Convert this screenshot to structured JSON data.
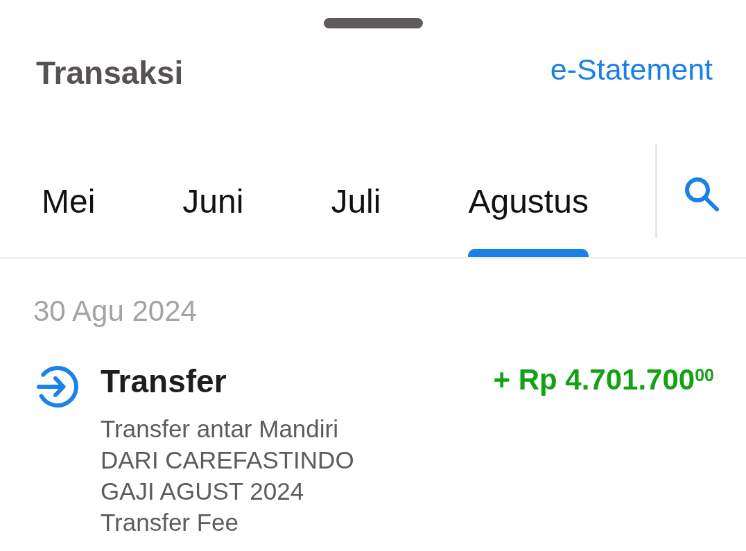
{
  "header": {
    "title": "Transaksi",
    "link": "e-Statement"
  },
  "tabs": [
    {
      "label": "Mei",
      "selected": false
    },
    {
      "label": "Juni",
      "selected": false
    },
    {
      "label": "Juli",
      "selected": false
    },
    {
      "label": "Agustus",
      "selected": true
    }
  ],
  "groups": [
    {
      "date": "30 Agu 2024",
      "transactions": [
        {
          "title": "Transfer",
          "amount": "+ Rp 4.701.700$^{00}$",
          "details": [
            "Transfer antar Mandiri",
            "DARI CAREFASTINDO",
            "GAJI AGUST 2024",
            "Transfer Fee"
          ]
        }
      ]
    }
  ]
}
